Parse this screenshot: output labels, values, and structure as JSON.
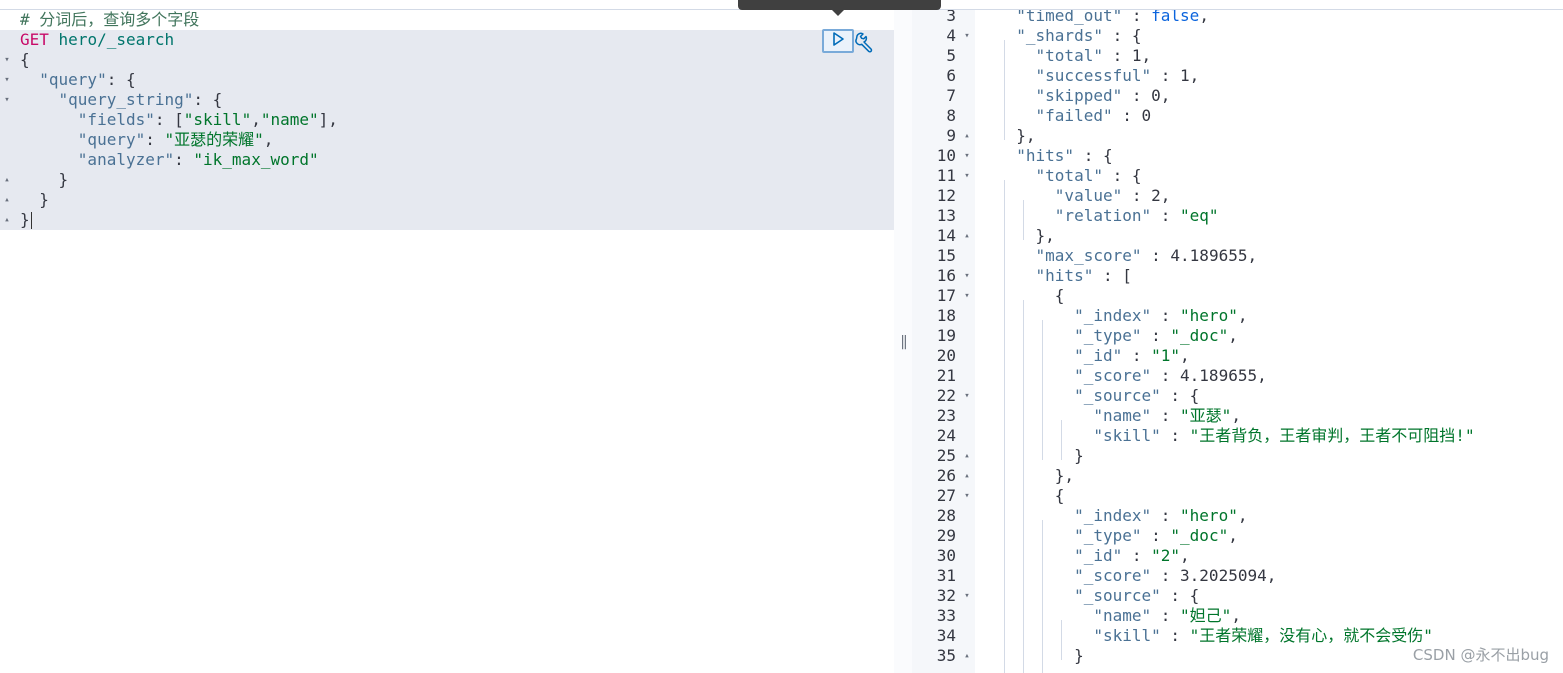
{
  "request": {
    "lines": [
      {
        "fold": "",
        "sel": false,
        "tokens": [
          [
            "comment",
            "# 分词后，查询多个字段"
          ]
        ]
      },
      {
        "fold": "",
        "sel": true,
        "tokens": [
          [
            "method",
            "GET"
          ],
          [
            "punc",
            " "
          ],
          [
            "url",
            "hero/_search"
          ]
        ]
      },
      {
        "fold": "▾",
        "sel": true,
        "tokens": [
          [
            "punc",
            "{"
          ]
        ]
      },
      {
        "fold": "▾",
        "sel": true,
        "tokens": [
          [
            "punc",
            "  "
          ],
          [
            "key",
            "\"query\""
          ],
          [
            "punc",
            ": {"
          ]
        ]
      },
      {
        "fold": "▾",
        "sel": true,
        "tokens": [
          [
            "punc",
            "    "
          ],
          [
            "key",
            "\"query_string\""
          ],
          [
            "punc",
            ": {"
          ]
        ]
      },
      {
        "fold": "",
        "sel": true,
        "tokens": [
          [
            "punc",
            "      "
          ],
          [
            "key",
            "\"fields\""
          ],
          [
            "punc",
            ": ["
          ],
          [
            "str",
            "\"skill\""
          ],
          [
            "punc",
            ","
          ],
          [
            "str",
            "\"name\""
          ],
          [
            "punc",
            "],"
          ]
        ]
      },
      {
        "fold": "",
        "sel": true,
        "tokens": [
          [
            "punc",
            "      "
          ],
          [
            "key",
            "\"query\""
          ],
          [
            "punc",
            ": "
          ],
          [
            "str",
            "\"亚瑟的荣耀\""
          ],
          [
            "punc",
            ","
          ]
        ]
      },
      {
        "fold": "",
        "sel": true,
        "tokens": [
          [
            "punc",
            "      "
          ],
          [
            "key",
            "\"analyzer\""
          ],
          [
            "punc",
            ": "
          ],
          [
            "str",
            "\"ik_max_word\""
          ]
        ]
      },
      {
        "fold": "▴",
        "sel": true,
        "tokens": [
          [
            "punc",
            "    }"
          ]
        ]
      },
      {
        "fold": "▴",
        "sel": true,
        "tokens": [
          [
            "punc",
            "  }"
          ]
        ]
      },
      {
        "fold": "▴",
        "sel": true,
        "tokens": [
          [
            "punc",
            "}"
          ]
        ],
        "cursor": true
      }
    ]
  },
  "actions": {
    "play_icon": "play-icon",
    "wrench_icon": "wrench-icon"
  },
  "response": {
    "lines": [
      {
        "n": "3",
        "fold": "",
        "tokens": [
          [
            "punc",
            "  "
          ],
          [
            "key",
            "\"timed_out\""
          ],
          [
            "punc",
            " : "
          ],
          [
            "bool",
            "false"
          ],
          [
            "punc",
            ","
          ]
        ]
      },
      {
        "n": "4",
        "fold": "▾",
        "tokens": [
          [
            "punc",
            "  "
          ],
          [
            "key",
            "\"_shards\""
          ],
          [
            "punc",
            " : {"
          ]
        ]
      },
      {
        "n": "5",
        "fold": "",
        "tokens": [
          [
            "punc",
            "    "
          ],
          [
            "key",
            "\"total\""
          ],
          [
            "punc",
            " : "
          ],
          [
            "num",
            "1"
          ],
          [
            "punc",
            ","
          ]
        ]
      },
      {
        "n": "6",
        "fold": "",
        "tokens": [
          [
            "punc",
            "    "
          ],
          [
            "key",
            "\"successful\""
          ],
          [
            "punc",
            " : "
          ],
          [
            "num",
            "1"
          ],
          [
            "punc",
            ","
          ]
        ]
      },
      {
        "n": "7",
        "fold": "",
        "tokens": [
          [
            "punc",
            "    "
          ],
          [
            "key",
            "\"skipped\""
          ],
          [
            "punc",
            " : "
          ],
          [
            "num",
            "0"
          ],
          [
            "punc",
            ","
          ]
        ]
      },
      {
        "n": "8",
        "fold": "",
        "tokens": [
          [
            "punc",
            "    "
          ],
          [
            "key",
            "\"failed\""
          ],
          [
            "punc",
            " : "
          ],
          [
            "num",
            "0"
          ]
        ]
      },
      {
        "n": "9",
        "fold": "▴",
        "tokens": [
          [
            "punc",
            "  },"
          ]
        ]
      },
      {
        "n": "10",
        "fold": "▾",
        "tokens": [
          [
            "punc",
            "  "
          ],
          [
            "key",
            "\"hits\""
          ],
          [
            "punc",
            " : {"
          ]
        ]
      },
      {
        "n": "11",
        "fold": "▾",
        "tokens": [
          [
            "punc",
            "    "
          ],
          [
            "key",
            "\"total\""
          ],
          [
            "punc",
            " : {"
          ]
        ]
      },
      {
        "n": "12",
        "fold": "",
        "tokens": [
          [
            "punc",
            "      "
          ],
          [
            "key",
            "\"value\""
          ],
          [
            "punc",
            " : "
          ],
          [
            "num",
            "2"
          ],
          [
            "punc",
            ","
          ]
        ]
      },
      {
        "n": "13",
        "fold": "",
        "tokens": [
          [
            "punc",
            "      "
          ],
          [
            "key",
            "\"relation\""
          ],
          [
            "punc",
            " : "
          ],
          [
            "str",
            "\"eq\""
          ]
        ]
      },
      {
        "n": "14",
        "fold": "▴",
        "tokens": [
          [
            "punc",
            "    },"
          ]
        ]
      },
      {
        "n": "15",
        "fold": "",
        "tokens": [
          [
            "punc",
            "    "
          ],
          [
            "key",
            "\"max_score\""
          ],
          [
            "punc",
            " : "
          ],
          [
            "num",
            "4.189655"
          ],
          [
            "punc",
            ","
          ]
        ]
      },
      {
        "n": "16",
        "fold": "▾",
        "tokens": [
          [
            "punc",
            "    "
          ],
          [
            "key",
            "\"hits\""
          ],
          [
            "punc",
            " : ["
          ]
        ]
      },
      {
        "n": "17",
        "fold": "▾",
        "tokens": [
          [
            "punc",
            "      {"
          ]
        ]
      },
      {
        "n": "18",
        "fold": "",
        "tokens": [
          [
            "punc",
            "        "
          ],
          [
            "key",
            "\"_index\""
          ],
          [
            "punc",
            " : "
          ],
          [
            "str",
            "\"hero\""
          ],
          [
            "punc",
            ","
          ]
        ]
      },
      {
        "n": "19",
        "fold": "",
        "tokens": [
          [
            "punc",
            "        "
          ],
          [
            "key",
            "\"_type\""
          ],
          [
            "punc",
            " : "
          ],
          [
            "str",
            "\"_doc\""
          ],
          [
            "punc",
            ","
          ]
        ]
      },
      {
        "n": "20",
        "fold": "",
        "tokens": [
          [
            "punc",
            "        "
          ],
          [
            "key",
            "\"_id\""
          ],
          [
            "punc",
            " : "
          ],
          [
            "str",
            "\"1\""
          ],
          [
            "punc",
            ","
          ]
        ]
      },
      {
        "n": "21",
        "fold": "",
        "tokens": [
          [
            "punc",
            "        "
          ],
          [
            "key",
            "\"_score\""
          ],
          [
            "punc",
            " : "
          ],
          [
            "num",
            "4.189655"
          ],
          [
            "punc",
            ","
          ]
        ]
      },
      {
        "n": "22",
        "fold": "▾",
        "tokens": [
          [
            "punc",
            "        "
          ],
          [
            "key",
            "\"_source\""
          ],
          [
            "punc",
            " : {"
          ]
        ]
      },
      {
        "n": "23",
        "fold": "",
        "tokens": [
          [
            "punc",
            "          "
          ],
          [
            "key",
            "\"name\""
          ],
          [
            "punc",
            " : "
          ],
          [
            "str",
            "\"亚瑟\""
          ],
          [
            "punc",
            ","
          ]
        ]
      },
      {
        "n": "24",
        "fold": "",
        "tokens": [
          [
            "punc",
            "          "
          ],
          [
            "key",
            "\"skill\""
          ],
          [
            "punc",
            " : "
          ],
          [
            "str",
            "\"王者背负，王者审判，王者不可阻挡!\""
          ]
        ]
      },
      {
        "n": "25",
        "fold": "▴",
        "tokens": [
          [
            "punc",
            "        }"
          ]
        ]
      },
      {
        "n": "26",
        "fold": "▴",
        "tokens": [
          [
            "punc",
            "      },"
          ]
        ]
      },
      {
        "n": "27",
        "fold": "▾",
        "tokens": [
          [
            "punc",
            "      {"
          ]
        ]
      },
      {
        "n": "28",
        "fold": "",
        "tokens": [
          [
            "punc",
            "        "
          ],
          [
            "key",
            "\"_index\""
          ],
          [
            "punc",
            " : "
          ],
          [
            "str",
            "\"hero\""
          ],
          [
            "punc",
            ","
          ]
        ]
      },
      {
        "n": "29",
        "fold": "",
        "tokens": [
          [
            "punc",
            "        "
          ],
          [
            "key",
            "\"_type\""
          ],
          [
            "punc",
            " : "
          ],
          [
            "str",
            "\"_doc\""
          ],
          [
            "punc",
            ","
          ]
        ]
      },
      {
        "n": "30",
        "fold": "",
        "tokens": [
          [
            "punc",
            "        "
          ],
          [
            "key",
            "\"_id\""
          ],
          [
            "punc",
            " : "
          ],
          [
            "str",
            "\"2\""
          ],
          [
            "punc",
            ","
          ]
        ]
      },
      {
        "n": "31",
        "fold": "",
        "tokens": [
          [
            "punc",
            "        "
          ],
          [
            "key",
            "\"_score\""
          ],
          [
            "punc",
            " : "
          ],
          [
            "num",
            "3.2025094"
          ],
          [
            "punc",
            ","
          ]
        ]
      },
      {
        "n": "32",
        "fold": "▾",
        "tokens": [
          [
            "punc",
            "        "
          ],
          [
            "key",
            "\"_source\""
          ],
          [
            "punc",
            " : {"
          ]
        ]
      },
      {
        "n": "33",
        "fold": "",
        "tokens": [
          [
            "punc",
            "          "
          ],
          [
            "key",
            "\"name\""
          ],
          [
            "punc",
            " : "
          ],
          [
            "str",
            "\"妲己\""
          ],
          [
            "punc",
            ","
          ]
        ]
      },
      {
        "n": "34",
        "fold": "",
        "tokens": [
          [
            "punc",
            "          "
          ],
          [
            "key",
            "\"skill\""
          ],
          [
            "punc",
            " : "
          ],
          [
            "str",
            "\"王者荣耀，没有心，就不会受伤\""
          ]
        ]
      },
      {
        "n": "35",
        "fold": "▴",
        "tokens": [
          [
            "punc",
            "        }"
          ]
        ]
      }
    ]
  },
  "divider_grip": "||",
  "watermark": "CSDN @永不出bug",
  "colors": {
    "method": "#c80a68",
    "url": "#00756c",
    "key": "#4a7194",
    "string": "#00752b",
    "bool": "#0b64dd",
    "comment": "#41755c"
  }
}
